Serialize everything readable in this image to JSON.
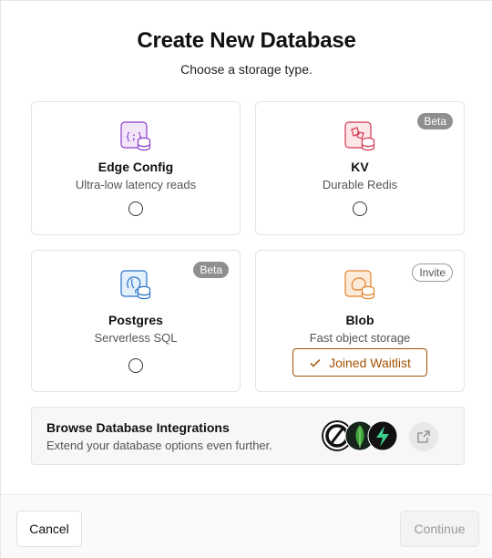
{
  "dialog": {
    "title": "Create New Database",
    "subtitle": "Choose a storage type."
  },
  "options": [
    {
      "name": "Edge Config",
      "description": "Ultra-low latency reads",
      "icon": "edge-config-icon",
      "accent": "#8a3ec8",
      "badge": ""
    },
    {
      "name": "KV",
      "description": "Durable Redis",
      "icon": "kv-icon",
      "accent": "#d2374f",
      "badge": "Beta"
    },
    {
      "name": "Postgres",
      "description": "Serverless SQL",
      "icon": "postgres-icon",
      "accent": "#2a72c9",
      "badge": "Beta"
    },
    {
      "name": "Blob",
      "description": "Fast object storage",
      "icon": "blob-icon",
      "accent": "#e4822a",
      "badge": "Invite",
      "action": "Joined Waitlist"
    }
  ],
  "integrations": {
    "title": "Browse Database Integrations",
    "subtitle": "Extend your database options even further.",
    "logos": [
      "integration-logo-1",
      "integration-logo-2",
      "integration-logo-3"
    ]
  },
  "footer": {
    "cancel_label": "Cancel",
    "continue_label": "Continue"
  },
  "colors": {
    "accent_orange": "#a35200",
    "badge_gray": "#8f8f8f"
  }
}
